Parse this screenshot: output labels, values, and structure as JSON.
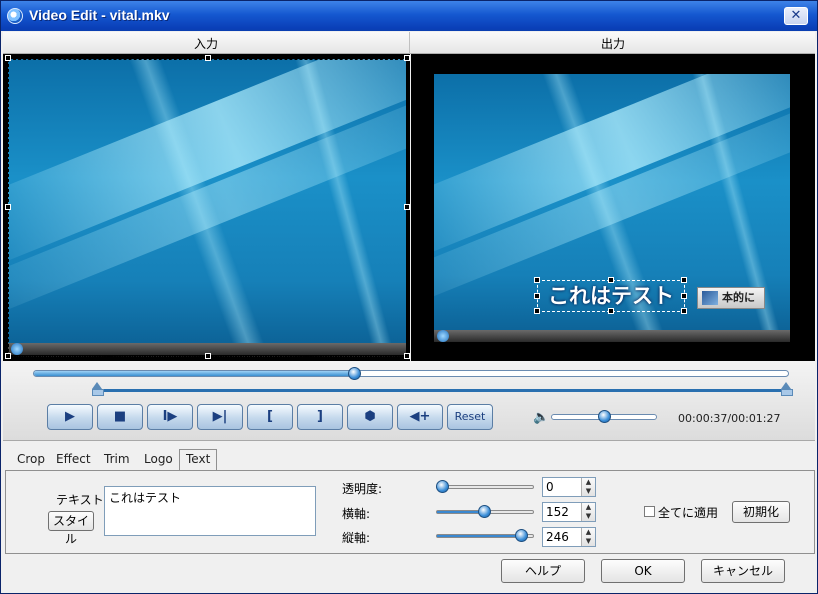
{
  "window": {
    "title": "Video Edit - vital.mkv",
    "close_label": "✕"
  },
  "preview": {
    "input_label": "入力",
    "output_label": "出力",
    "overlay_text": "これはテスト",
    "logo_text": "本的に"
  },
  "playback": {
    "seek_progress": 0.425,
    "volume_level": 0.5,
    "time_readout": "00:00:37/00:01:27",
    "buttons": [
      {
        "name": "play-button",
        "icon": "play-icon",
        "glyph": "▶"
      },
      {
        "name": "stop-button",
        "icon": "stop-icon",
        "glyph": "■"
      },
      {
        "name": "next-frame-button",
        "icon": "step-forward-icon",
        "glyph": "I▶"
      },
      {
        "name": "end-button",
        "icon": "skip-end-icon",
        "glyph": "▶|"
      },
      {
        "name": "mark-in-button",
        "icon": "mark-in-icon",
        "glyph": "["
      },
      {
        "name": "mark-out-button",
        "icon": "mark-out-icon",
        "glyph": "]"
      },
      {
        "name": "snapshot-button",
        "icon": "cube-icon",
        "glyph": "⬢"
      },
      {
        "name": "add-clip-button",
        "icon": "add-clip-icon",
        "glyph": "◀+"
      },
      {
        "name": "reset-button",
        "icon": "",
        "glyph": "Reset"
      }
    ]
  },
  "tabs": [
    {
      "label": "Crop",
      "active": false
    },
    {
      "label": "Effect",
      "active": false
    },
    {
      "label": "Trim",
      "active": false
    },
    {
      "label": "Logo",
      "active": false
    },
    {
      "label": "Text",
      "active": true
    }
  ],
  "text_panel": {
    "text_label": "テキスト:",
    "style_button": "スタイル",
    "text_value": "これはテスト",
    "opacity_label": "透明度:",
    "opacity_value": "0",
    "opacity_level": 0.0,
    "horizontal_label": "横軸:",
    "horizontal_value": "152",
    "horizontal_level": 0.47,
    "vertical_label": "縦軸:",
    "vertical_value": "246",
    "vertical_level": 0.88,
    "apply_all_label": "全てに適用",
    "apply_all_checked": false,
    "initialize_button": "初期化"
  },
  "footer": {
    "help_button": "ヘルプ",
    "ok_button": "OK",
    "cancel_button": "キャンセル"
  }
}
